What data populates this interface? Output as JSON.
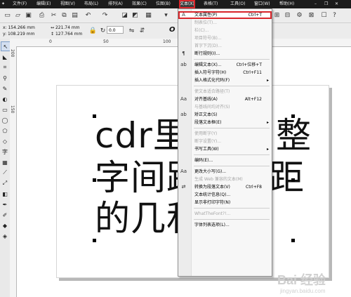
{
  "menubar": {
    "items": [
      {
        "label": "文件(F)"
      },
      {
        "label": "编辑(E)"
      },
      {
        "label": "视图(V)"
      },
      {
        "label": "布局(L)"
      },
      {
        "label": "排列(A)"
      },
      {
        "label": "效果(C)"
      },
      {
        "label": "位图(B)"
      },
      {
        "label": "文本(X)",
        "active": true
      },
      {
        "label": "表格(T)"
      },
      {
        "label": "工具(O)"
      },
      {
        "label": "窗口(W)"
      },
      {
        "label": "帮助(H)"
      }
    ]
  },
  "property_bar": {
    "x": "x: 154.266 mm",
    "y": "y: 108.219 mm",
    "width": "221.74 mm",
    "height": "127.764 mm",
    "angle": "0.0",
    "font_glyph": "O"
  },
  "rulers": {
    "h_marks": [
      "0",
      "50",
      "100"
    ],
    "v_marks": [
      "200",
      "150"
    ]
  },
  "canvas": {
    "lines": [
      "cdr里",
      "字间跑",
      "的几和"
    ],
    "line_tails": [
      "整",
      "距",
      ""
    ]
  },
  "text_menu": {
    "items": [
      {
        "icon": "text-properties-icon",
        "label": "文本属性(P)",
        "shortcut": "Ctrl+T",
        "highlighted": true
      },
      {
        "icon": "",
        "label": "制表位(T)...",
        "disabled": true
      },
      {
        "icon": "",
        "label": "栏(C)...",
        "disabled": true
      },
      {
        "icon": "",
        "label": "项目符号(B)...",
        "disabled": true
      },
      {
        "icon": "",
        "label": "首字下沉(D)...",
        "disabled": true
      },
      {
        "icon": "paragraph-break-icon",
        "label": "断行规则(I)..."
      },
      {
        "sep": true
      },
      {
        "icon": "edit-text-icon",
        "label": "编辑文本(X)...",
        "shortcut": "Ctrl+位移+T"
      },
      {
        "icon": "",
        "label": "插入符号字符(H)",
        "shortcut": "Ctrl+F11"
      },
      {
        "icon": "",
        "label": "插入格式化代码(F)",
        "arrow": true
      },
      {
        "sep": true
      },
      {
        "icon": "",
        "label": "使文本适合路径(T)",
        "disabled": true
      },
      {
        "icon": "align-baseline-icon",
        "label": "对齐基线(A)",
        "shortcut": "Alt+F12"
      },
      {
        "icon": "",
        "label": "与基线间均对齐(S)",
        "disabled": true
      },
      {
        "icon": "straighten-text-icon",
        "label": "矫正文本(S)"
      },
      {
        "icon": "",
        "label": "段落文本框(E)",
        "arrow": true
      },
      {
        "sep": true
      },
      {
        "icon": "",
        "label": "使用断字(Y)",
        "disabled": true
      },
      {
        "icon": "",
        "label": "断字设置(Y)...",
        "disabled": true
      },
      {
        "icon": "",
        "label": "书写工具(W)",
        "arrow": true
      },
      {
        "sep": true
      },
      {
        "icon": "",
        "label": "编码(E)..."
      },
      {
        "sep": true
      },
      {
        "icon": "change-case-icon",
        "label": "更改大小写(G)..."
      },
      {
        "icon": "",
        "label": "生成 Web 兼容的文本(M)",
        "disabled": true
      },
      {
        "icon": "convert-icon",
        "label": "转换为段落文本(V)",
        "shortcut": "Ctrl+F8"
      },
      {
        "icon": "",
        "label": "文本统计信息(Q)..."
      },
      {
        "icon": "",
        "label": "显示非打印字符(N)"
      },
      {
        "sep": true
      },
      {
        "icon": "",
        "label": "WhatTheFont?!...",
        "disabled": true
      },
      {
        "sep": true
      },
      {
        "icon": "",
        "label": "字体列表选项(L)..."
      }
    ]
  },
  "watermark": {
    "text": "Bai 经验",
    "sub": "jingyan.baidu.com"
  }
}
